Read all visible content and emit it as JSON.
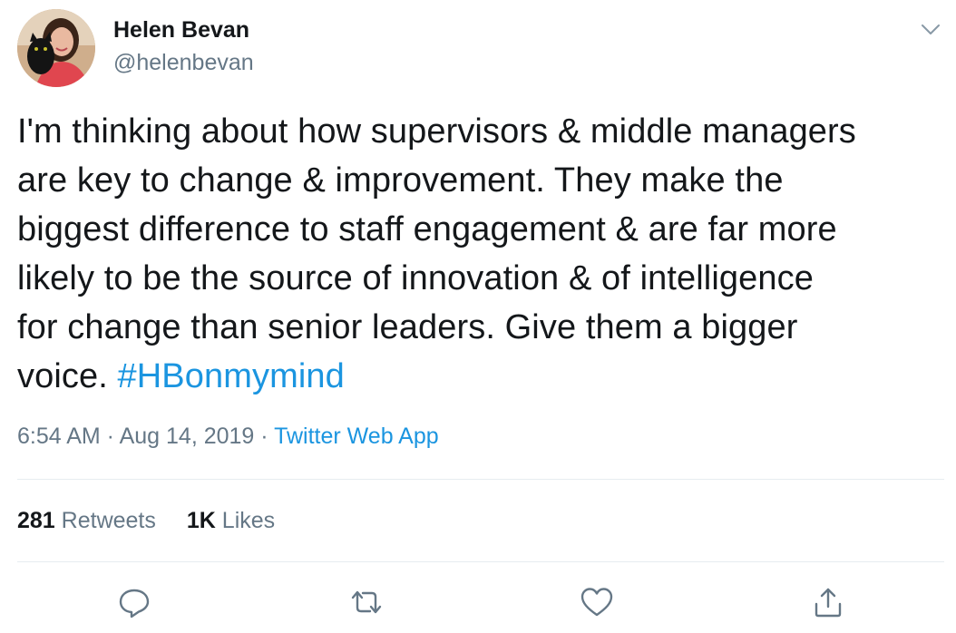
{
  "author": {
    "name": "Helen Bevan",
    "handle": "@helenbevan",
    "avatar_icon": "profile-photo-with-black-cat"
  },
  "tweet": {
    "lines": [
      "I'm thinking about how supervisors & middle managers",
      "are key to change & improvement. They make the",
      "biggest difference to staff engagement & are far more",
      "likely to be the source of innovation & of intelligence",
      "for change than senior leaders. Give them a bigger"
    ],
    "last_line_text": "voice. ",
    "hashtag": "#HBonmymind"
  },
  "meta": {
    "time": "6:54 AM",
    "separator": " · ",
    "date": "Aug 14, 2019",
    "source": "Twitter Web App"
  },
  "stats": {
    "retweets_count": "281",
    "retweets_label": " Retweets",
    "likes_count": "1K",
    "likes_label": " Likes"
  },
  "actions": {
    "reply_icon": "reply-icon",
    "retweet_icon": "retweet-icon",
    "like_icon": "heart-icon",
    "share_icon": "share-icon"
  },
  "colors": {
    "text": "#14171a",
    "secondary": "#657786",
    "link": "#1b95e0",
    "divider": "#e6ecf0"
  }
}
